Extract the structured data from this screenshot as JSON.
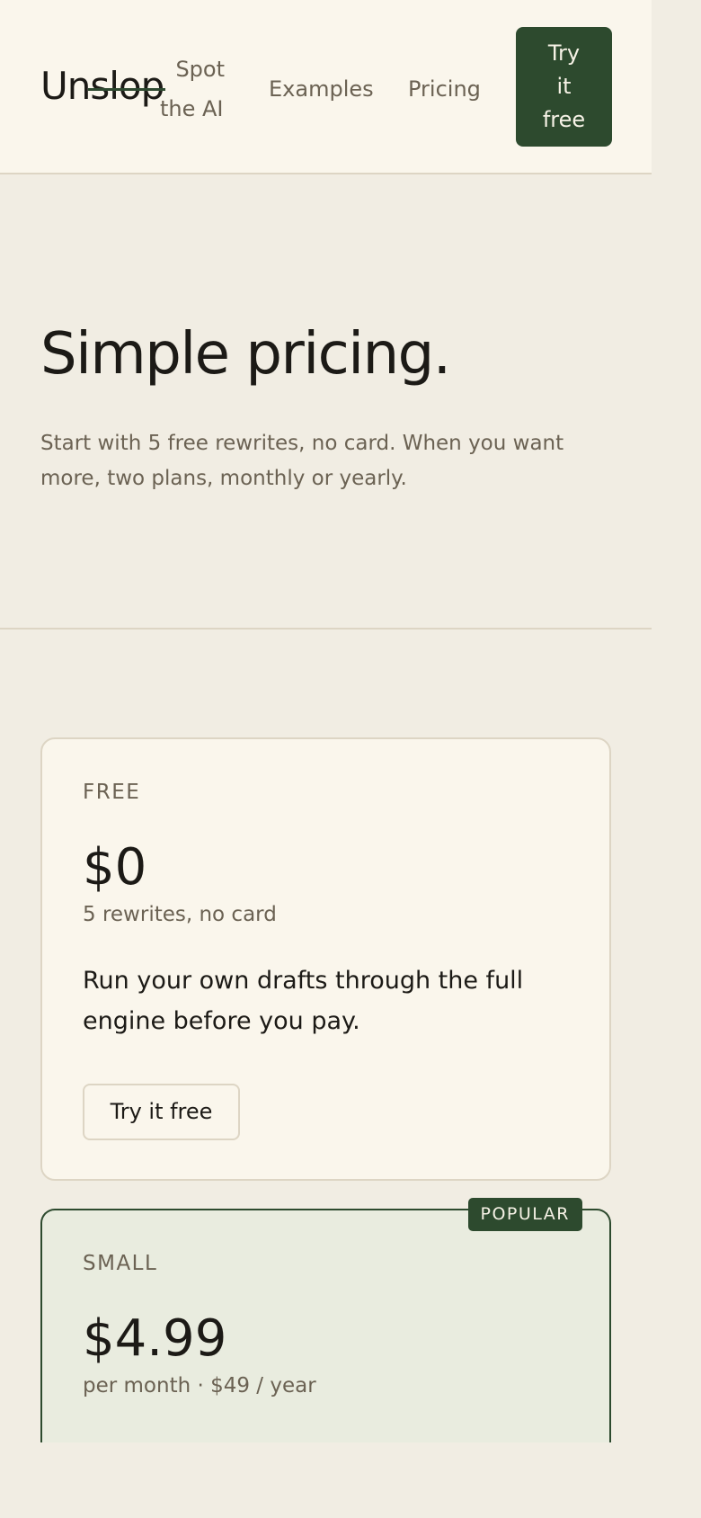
{
  "header": {
    "logo_prefix": "Un",
    "logo_struck": "slop",
    "nav": {
      "spot_line1": "Spot",
      "spot_line2": "the AI",
      "examples": "Examples",
      "pricing": "Pricing"
    },
    "cta_lines": [
      "Try",
      "it",
      "free"
    ]
  },
  "hero": {
    "title": "Simple pricing.",
    "subtitle": "Start with 5 free rewrites, no card. When you want more, two plans, monthly or yearly."
  },
  "plans": [
    {
      "tier": "FREE",
      "price": "$0",
      "note": "5 rewrites, no card",
      "description": "Run your own drafts through the full engine before you pay.",
      "button": "Try it free"
    },
    {
      "badge": "POPULAR",
      "tier": "SMALL",
      "price": "$4.99",
      "note": "per month · $49 / year"
    }
  ],
  "colors": {
    "accent": "#2d4a2e",
    "page_bg": "#f1ede3",
    "card_bg": "#faf6ec",
    "popular_bg": "#e9ecdf",
    "muted_text": "#6b6253"
  }
}
